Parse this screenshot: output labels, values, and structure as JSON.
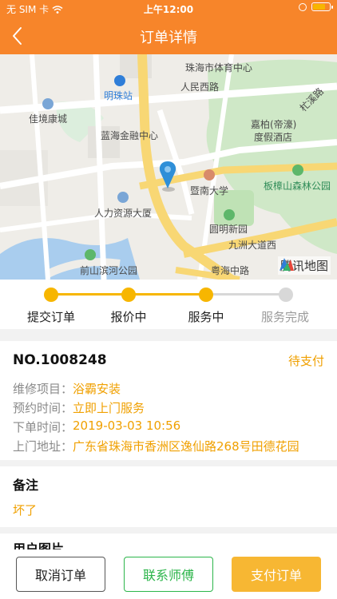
{
  "status_bar": {
    "carrier": "无 SIM 卡",
    "time": "上午12:00"
  },
  "nav": {
    "title": "订单详情"
  },
  "map": {
    "labels": [
      "珠海市体育中心",
      "人民西路",
      "明珠站",
      "佳境康城",
      "蓝海金融中心",
      "嘉柏(帝濠)",
      "度假酒店",
      "杧溪路",
      "暨南大学",
      "板樟山森林公园",
      "人力资源大厦",
      "圆明新园",
      "九洲大道西",
      "前山滨河公园",
      "粤海中路"
    ],
    "provider": "腾讯地图"
  },
  "steps": [
    {
      "label": "提交订单",
      "done": true
    },
    {
      "label": "报价中",
      "done": true
    },
    {
      "label": "服务中",
      "done": true
    },
    {
      "label": "服务完成",
      "done": false
    }
  ],
  "order": {
    "number": "NO.1008248",
    "status": "待支付",
    "fields": [
      {
        "key": "维修项目：",
        "value": "浴霸安装"
      },
      {
        "key": "预约时间：",
        "value": "立即上门服务"
      },
      {
        "key": "下单时间：",
        "value": "2019-03-03 10:56"
      },
      {
        "key": "上门地址：",
        "value": "广东省珠海市香洲区逸仙路268号田德花园"
      }
    ]
  },
  "remark": {
    "title": "备注",
    "text": "坏了"
  },
  "photos": {
    "title": "用户图片"
  },
  "actions": {
    "cancel": "取消订单",
    "contact": "联系师傅",
    "pay": "支付订单"
  },
  "colors": {
    "primary": "#f7852a",
    "accent": "#f0a000",
    "green": "#2cb54a",
    "step": "#f7b600"
  }
}
